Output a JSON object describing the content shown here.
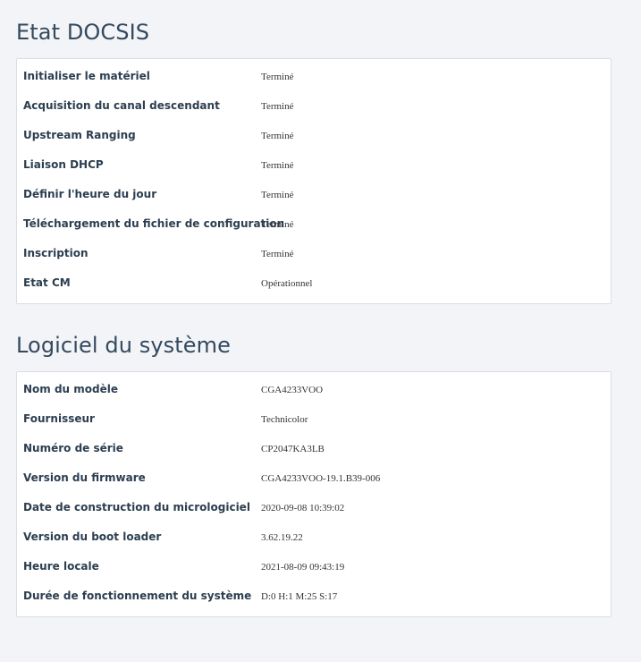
{
  "docsis": {
    "title": "Etat DOCSIS",
    "rows": [
      {
        "label": "Initialiser le matériel",
        "value": "Terminé"
      },
      {
        "label": "Acquisition du canal descendant",
        "value": "Terminé"
      },
      {
        "label": "Upstream Ranging",
        "value": "Terminé"
      },
      {
        "label": "Liaison DHCP",
        "value": "Terminé"
      },
      {
        "label": "Définir l'heure du jour",
        "value": "Terminé"
      },
      {
        "label": "Téléchargement du fichier de configuration",
        "value": "Terminé"
      },
      {
        "label": "Inscription",
        "value": "Terminé"
      },
      {
        "label": "Etat CM",
        "value": "Opérationnel"
      }
    ]
  },
  "system": {
    "title": "Logiciel du système",
    "rows": [
      {
        "label": "Nom du modèle",
        "value": "CGA4233VOO"
      },
      {
        "label": "Fournisseur",
        "value": "Technicolor"
      },
      {
        "label": "Numéro de série",
        "value": "CP2047KA3LB"
      },
      {
        "label": "Version du firmware",
        "value": "CGA4233VOO-19.1.B39-006"
      },
      {
        "label": "Date de construction du micrologiciel",
        "value": "2020-09-08 10:39:02"
      },
      {
        "label": "Version du boot loader",
        "value": "3.62.19.22"
      },
      {
        "label": "Heure locale",
        "value": "2021-08-09 09:43:19"
      },
      {
        "label": "Durée de fonctionnement du système",
        "value": "D:0 H:1 M:25 S:17"
      }
    ]
  }
}
